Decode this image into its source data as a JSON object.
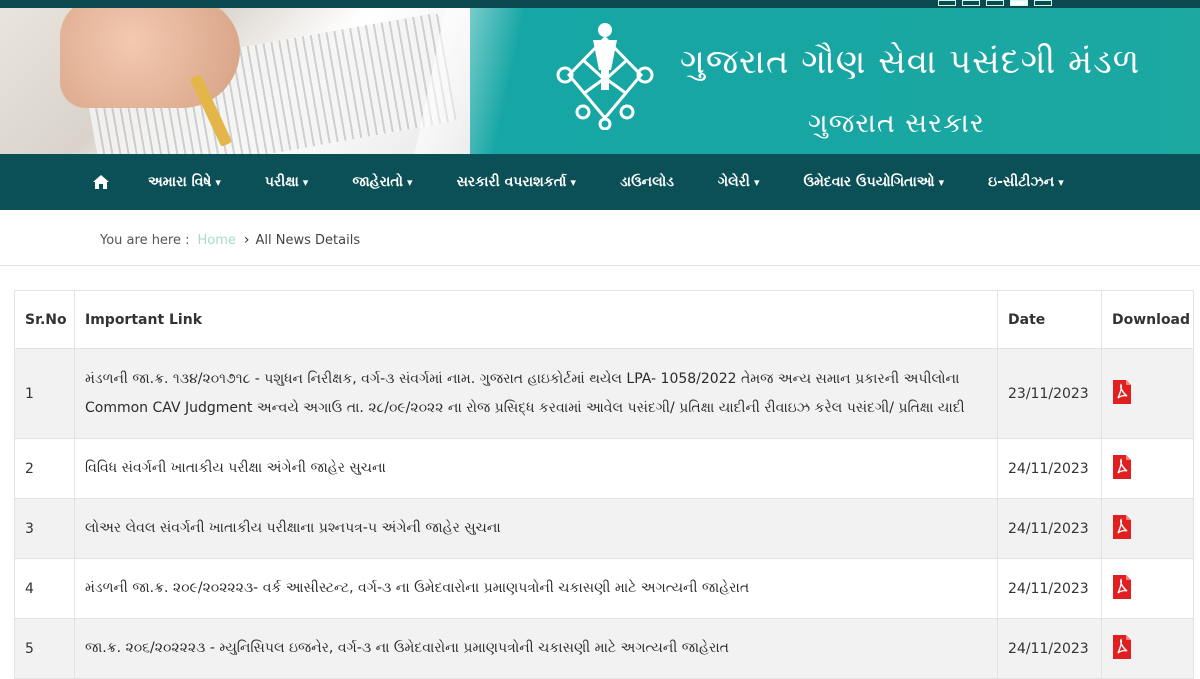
{
  "header": {
    "org_title": "ગુજરાત ગૌણ સેવા પસંદગી મંડળ",
    "org_subtitle": "ગુજરાત સરકાર"
  },
  "nav": {
    "items": [
      {
        "label": "અમારા વિષે",
        "dropdown": true
      },
      {
        "label": "પરીક્ષા",
        "dropdown": true
      },
      {
        "label": "જાહેરાતો",
        "dropdown": true
      },
      {
        "label": "સરકારી વપરાશકર્તા",
        "dropdown": true
      },
      {
        "label": "ડાઉનલોડ",
        "dropdown": false
      },
      {
        "label": "ગેલેરી",
        "dropdown": true
      },
      {
        "label": "ઉમેદવાર ઉપયોગિતાઓ",
        "dropdown": true
      },
      {
        "label": "ઇ-સીટીઝન",
        "dropdown": true
      }
    ]
  },
  "breadcrumb": {
    "prefix": "You are here :",
    "home": "Home",
    "current": "All News Details"
  },
  "table": {
    "headers": [
      "Sr.No",
      "Important Link",
      "Date",
      "Download"
    ],
    "rows": [
      {
        "sr": "1",
        "link": "મંડળની જા.ક્ર. ૧૩૪/૨૦૧૭૧૮ - પશુધન નિરીક્ષક, વર્ગ-૩ સંવર્ગમાં નામ. ગુજરાત હાઇકોર્ટમાં થયેલ LPA- 1058/2022 તેમજ અન્ય સમાન પ્રકારની અપીલોના Common CAV Judgment અન્વયે અગાઉ તા. ૨૮/૦૯/૨૦૨૨ ના રોજ પ્રસિદ્ધ કરવામાં આવેલ પસંદગી/ પ્રતિક્ષા યાદીની રીવાઇઝ કરેલ પસંદગી/ પ્રતિક્ષા યાદી",
        "date": "23/11/2023"
      },
      {
        "sr": "2",
        "link": "વિવિધ સંવર્ગની ખાતાકીય પરીક્ષા અંગેની જાહેર સુચના",
        "date": "24/11/2023"
      },
      {
        "sr": "3",
        "link": "લોઅર લેવલ સંવર્ગની ખાતાકીય પરીક્ષાના પ્રશ્નપત્ર-૫ અંગેની જાહેર સુચના",
        "date": "24/11/2023"
      },
      {
        "sr": "4",
        "link": "મંડળની જા.ક્ર. ૨૦૯/૨૦૨૨૨૩- વર્ક આસીસ્ટન્ટ, વર્ગ-૩ ના ઉમેદવારોના પ્રમાણપત્રોની ચકાસણી માટે અગત્યની જાહેરાત",
        "date": "24/11/2023"
      },
      {
        "sr": "5",
        "link": "જા.ક્ર. ૨૦૬/૨૦૨૨૨૩ - મ્યુનિસિપલ ઇજનેર, વર્ગ-૩ ના ઉમેદવારોના પ્રમાણપત્રોની ચકાસણી માટે અગત્યની જાહેરાત",
        "date": "24/11/2023"
      }
    ]
  },
  "colors": {
    "nav_bg": "#0c5057",
    "banner_teal": "#17a6a3",
    "pdf_red": "#e02020"
  },
  "icons": {
    "home": "home-icon",
    "pdf": "pdf-icon",
    "chevron": "chevron-down-icon"
  }
}
